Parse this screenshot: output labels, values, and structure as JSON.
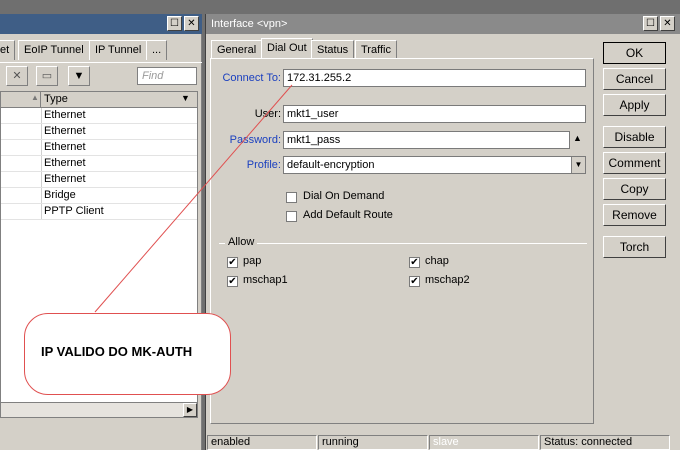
{
  "left_window": {
    "tabs": [
      "et",
      "EoIP Tunnel",
      "IP Tunnel",
      "..."
    ],
    "find_placeholder": "Find",
    "column_header": "Type",
    "rows": [
      "Ethernet",
      "Ethernet",
      "Ethernet",
      "Ethernet",
      "Ethernet",
      "Bridge",
      "PPTP Client"
    ]
  },
  "dialog": {
    "title": "Interface <vpn>",
    "tabs": [
      "General",
      "Dial Out",
      "Status",
      "Traffic"
    ],
    "active_tab": "Dial Out",
    "connect_to_label": "Connect To:",
    "connect_to": "172.31.255.2",
    "user_label": "User:",
    "user": "mkt1_user",
    "password_label": "Password:",
    "password": "mkt1_pass",
    "profile_label": "Profile:",
    "profile": "default-encryption",
    "dial_on_demand": "Dial On Demand",
    "add_default_route": "Add Default Route",
    "allow_label": "Allow",
    "allow": {
      "pap": "pap",
      "chap": "chap",
      "mschap1": "mschap1",
      "mschap2": "mschap2"
    },
    "buttons": {
      "ok": "OK",
      "cancel": "Cancel",
      "apply": "Apply",
      "disable": "Disable",
      "comment": "Comment",
      "copy": "Copy",
      "remove": "Remove",
      "torch": "Torch"
    },
    "status": {
      "enabled": "enabled",
      "running": "running",
      "slave": "slave",
      "connection": "Status: connected"
    }
  },
  "callout": {
    "text": "IP VALIDO DO MK-AUTH"
  },
  "colors": {
    "title_active": "#3f5e86",
    "title_inactive": "#8a8a8a",
    "label_blue": "#1a3fbf",
    "callout_line": "#e05050"
  }
}
